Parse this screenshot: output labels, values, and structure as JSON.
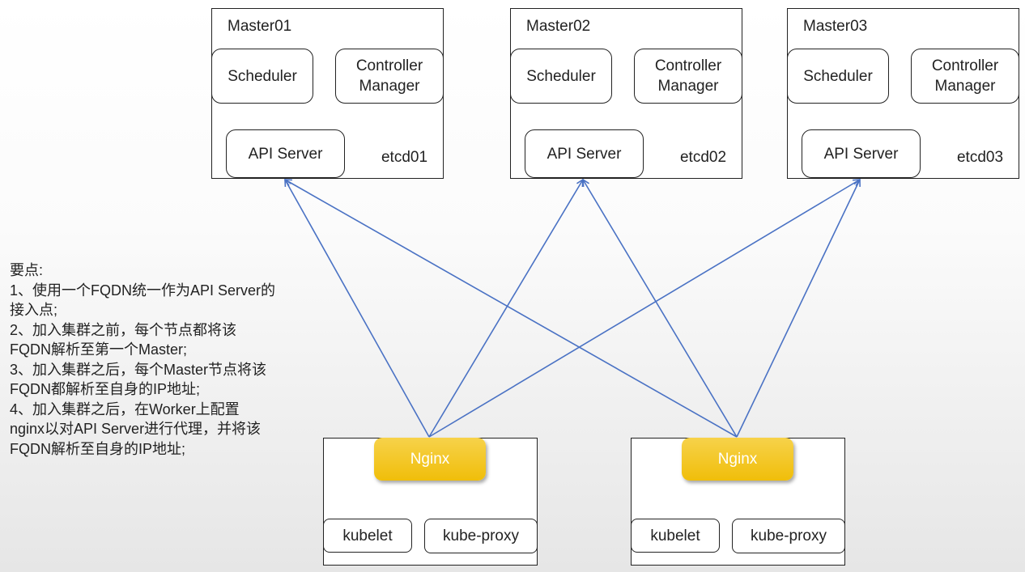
{
  "masters": [
    {
      "title": "Master01",
      "scheduler": "Scheduler",
      "controller": "Controller Manager",
      "api": "API Server",
      "etcd": "etcd01"
    },
    {
      "title": "Master02",
      "scheduler": "Scheduler",
      "controller": "Controller Manager",
      "api": "API Server",
      "etcd": "etcd02"
    },
    {
      "title": "Master03",
      "scheduler": "Scheduler",
      "controller": "Controller Manager",
      "api": "API Server",
      "etcd": "etcd03"
    }
  ],
  "workers": [
    {
      "proxy": "Nginx",
      "kubelet": "kubelet",
      "kube_proxy": "kube-proxy"
    },
    {
      "proxy": "Nginx",
      "kubelet": "kubelet",
      "kube_proxy": "kube-proxy"
    }
  ],
  "notes": [
    "要点:",
    "1、使用一个FQDN统一作为API Server的",
    "接入点;",
    "2、加入集群之前，每个节点都将该",
    "FQDN解析至第一个Master;",
    "3、加入集群之后，每个Master节点将该",
    "FQDN都解析至自身的IP地址;",
    "4、加入集群之后，在Worker上配置",
    "nginx以对API Server进行代理，并将该",
    "FQDN解析至自身的IP地址;"
  ],
  "colors": {
    "orange_arrow": "#e8804a",
    "blue_arrow": "#4a72c4",
    "etcd_border": "#7cc34a",
    "nginx": "#f3c318"
  }
}
